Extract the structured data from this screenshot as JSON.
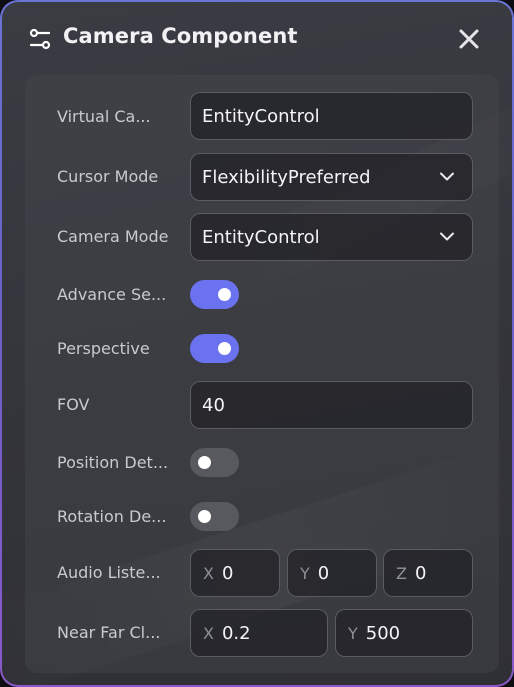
{
  "header": {
    "title": "Camera Component",
    "settings_icon": "sliders-icon",
    "close_icon": "close-icon"
  },
  "fields": {
    "virtual_camera": {
      "label": "Virtual Ca...",
      "value": "EntityControl"
    },
    "cursor_mode": {
      "label": "Cursor Mode",
      "value": "FlexibilityPreferred"
    },
    "camera_mode": {
      "label": "Camera Mode",
      "value": "EntityControl"
    },
    "advance_settings": {
      "label": "Advance Se...",
      "on": true
    },
    "perspective": {
      "label": "Perspective",
      "on": true
    },
    "fov": {
      "label": "FOV",
      "value": "40"
    },
    "position_detect": {
      "label": "Position Det...",
      "on": false
    },
    "rotation_detect": {
      "label": "Rotation De...",
      "on": false
    },
    "audio_listener": {
      "label": "Audio Liste...",
      "x_label": "X",
      "x": "0",
      "y_label": "Y",
      "y": "0",
      "z_label": "Z",
      "z": "0"
    },
    "near_far_clip": {
      "label": "Near Far Cl...",
      "x_label": "X",
      "x": "0.2",
      "y_label": "Y",
      "y": "500"
    }
  },
  "colors": {
    "toggle_on": "#6a72f0",
    "toggle_off": "#58595f",
    "border_gradient_top": "#6a73d6",
    "border_gradient_bottom": "#8a58c8"
  }
}
